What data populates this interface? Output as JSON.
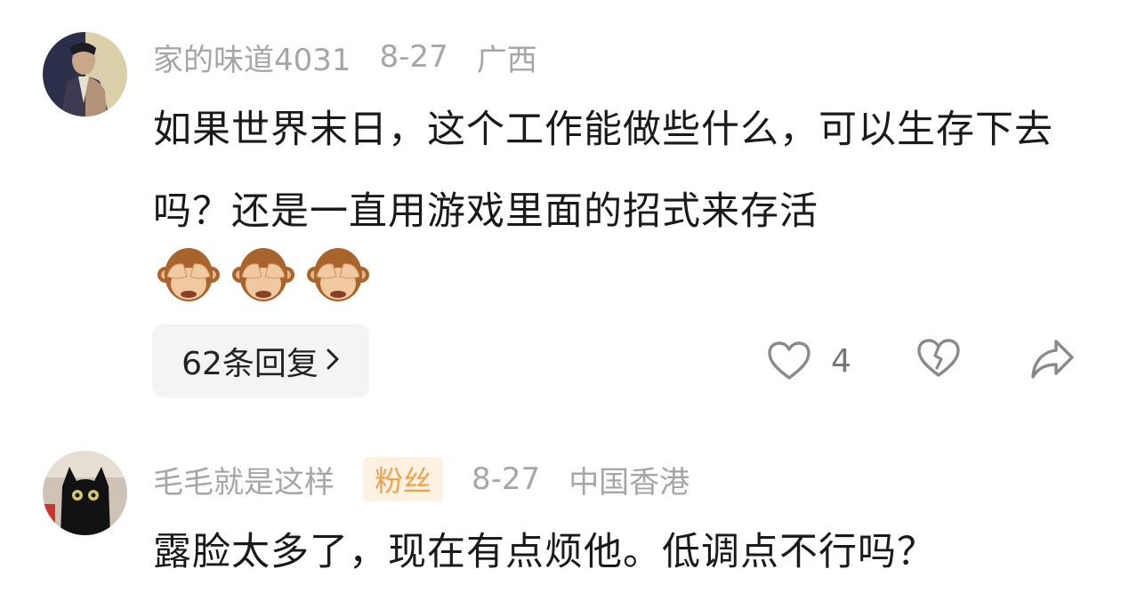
{
  "comments": [
    {
      "username": "家的味道4031",
      "date": "8-27",
      "location": "广西",
      "text": "如果世界末日，这个工作能做些什么，可以生存下去吗？还是一直用游戏里面的招式来存活",
      "emojis": [
        "see-no-evil-monkey",
        "see-no-evil-monkey",
        "see-no-evil-monkey"
      ],
      "reply_label": "62条回复",
      "likes": "4"
    },
    {
      "username": "毛毛就是这样",
      "badge": "粉丝",
      "date": "8-27",
      "location": "中国香港",
      "text": "露脸太多了，现在有点烦他。低调点不行吗？"
    }
  ],
  "colors": {
    "meta": "#a6a6a6",
    "text": "#1a1a1a",
    "badge_bg": "#fdf1e1",
    "badge_text": "#e7a454",
    "reply_bg": "#f4f4f4",
    "icon": "#8a8a8a"
  }
}
